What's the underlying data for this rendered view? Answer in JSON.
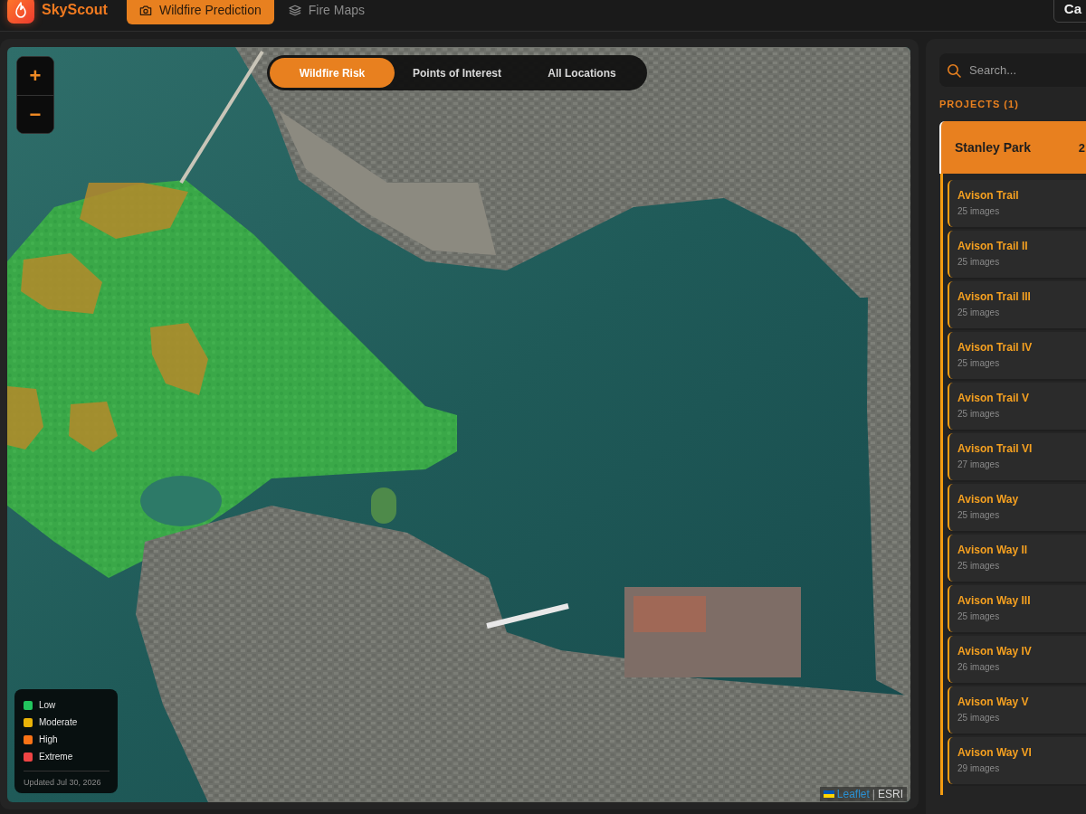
{
  "header": {
    "logo": "SkyScout",
    "tabs": [
      {
        "label": "Wildfire Prediction",
        "selected": true
      },
      {
        "label": "Fire Maps",
        "selected": false
      }
    ],
    "account_button": "Ca"
  },
  "map": {
    "zoom_in": "+",
    "zoom_out": "−",
    "layer_tabs": [
      {
        "label": "Wildfire Risk",
        "selected": true
      },
      {
        "label": "Points of Interest",
        "selected": false
      },
      {
        "label": "All Locations",
        "selected": false
      }
    ],
    "legend": {
      "items": [
        {
          "label": "Low",
          "color": "#22c55e"
        },
        {
          "label": "Moderate",
          "color": "#eab308"
        },
        {
          "label": "High",
          "color": "#f97316"
        },
        {
          "label": "Extreme",
          "color": "#ef4444"
        }
      ],
      "updated": "Updated Jul 30, 2026"
    },
    "attribution": {
      "link": "Leaflet",
      "separator": "|",
      "source": "ESRI"
    }
  },
  "sidebar": {
    "search": {
      "placeholder": "Search..."
    },
    "section_title": "PROJECTS (1)",
    "projects": [
      {
        "name": "Stanley Park",
        "count": "2",
        "selected": true,
        "expanded": true,
        "children": [
          {
            "name": "Avison Trail",
            "images": "25 images",
            "selected": false
          },
          {
            "name": "Avison Trail II",
            "images": "25 images",
            "selected": false
          },
          {
            "name": "Avison Trail III",
            "images": "25 images",
            "selected": false
          },
          {
            "name": "Avison Trail IV",
            "images": "25 images",
            "selected": false
          },
          {
            "name": "Avison Trail V",
            "images": "25 images",
            "selected": false
          },
          {
            "name": "Avison Trail VI",
            "images": "27 images",
            "selected": false
          },
          {
            "name": "Avison Way",
            "images": "25 images",
            "selected": false
          },
          {
            "name": "Avison Way II",
            "images": "25 images",
            "selected": false
          },
          {
            "name": "Avison Way III",
            "images": "25 images",
            "selected": false
          },
          {
            "name": "Avison Way IV",
            "images": "26 images",
            "selected": false
          },
          {
            "name": "Avison Way V",
            "images": "25 images",
            "selected": false
          },
          {
            "name": "Avison Way VI",
            "images": "29 images",
            "selected": false
          }
        ]
      }
    ]
  }
}
